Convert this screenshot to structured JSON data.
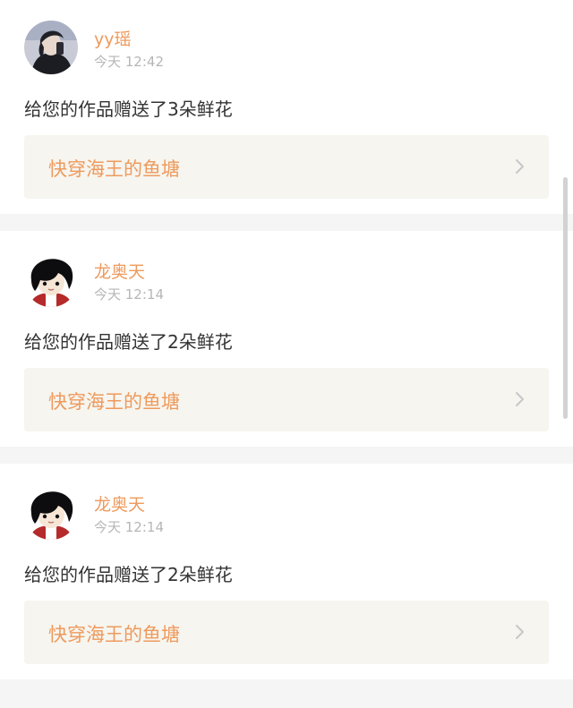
{
  "notifications": [
    {
      "avatar_icon": "user-photo-avatar",
      "username": "yy瑶",
      "time": "今天 12:42",
      "message": "给您的作品赠送了3朵鲜花",
      "work_title": "快穿海王的鱼塘"
    },
    {
      "avatar_icon": "cartoon-boy-avatar",
      "username": "龙奥天",
      "time": "今天 12:14",
      "message": "给您的作品赠送了2朵鲜花",
      "work_title": "快穿海王的鱼塘"
    },
    {
      "avatar_icon": "cartoon-boy-avatar",
      "username": "龙奥天",
      "time": "今天 12:14",
      "message": "给您的作品赠送了2朵鲜花",
      "work_title": "快穿海王的鱼塘"
    }
  ],
  "colors": {
    "accent": "#ee9a5d",
    "card_bg": "#ffffff",
    "page_bg": "#f5f5f5",
    "link_bg": "#f6f5ef",
    "time_text": "#b6b6b6",
    "body_text": "#333333"
  }
}
